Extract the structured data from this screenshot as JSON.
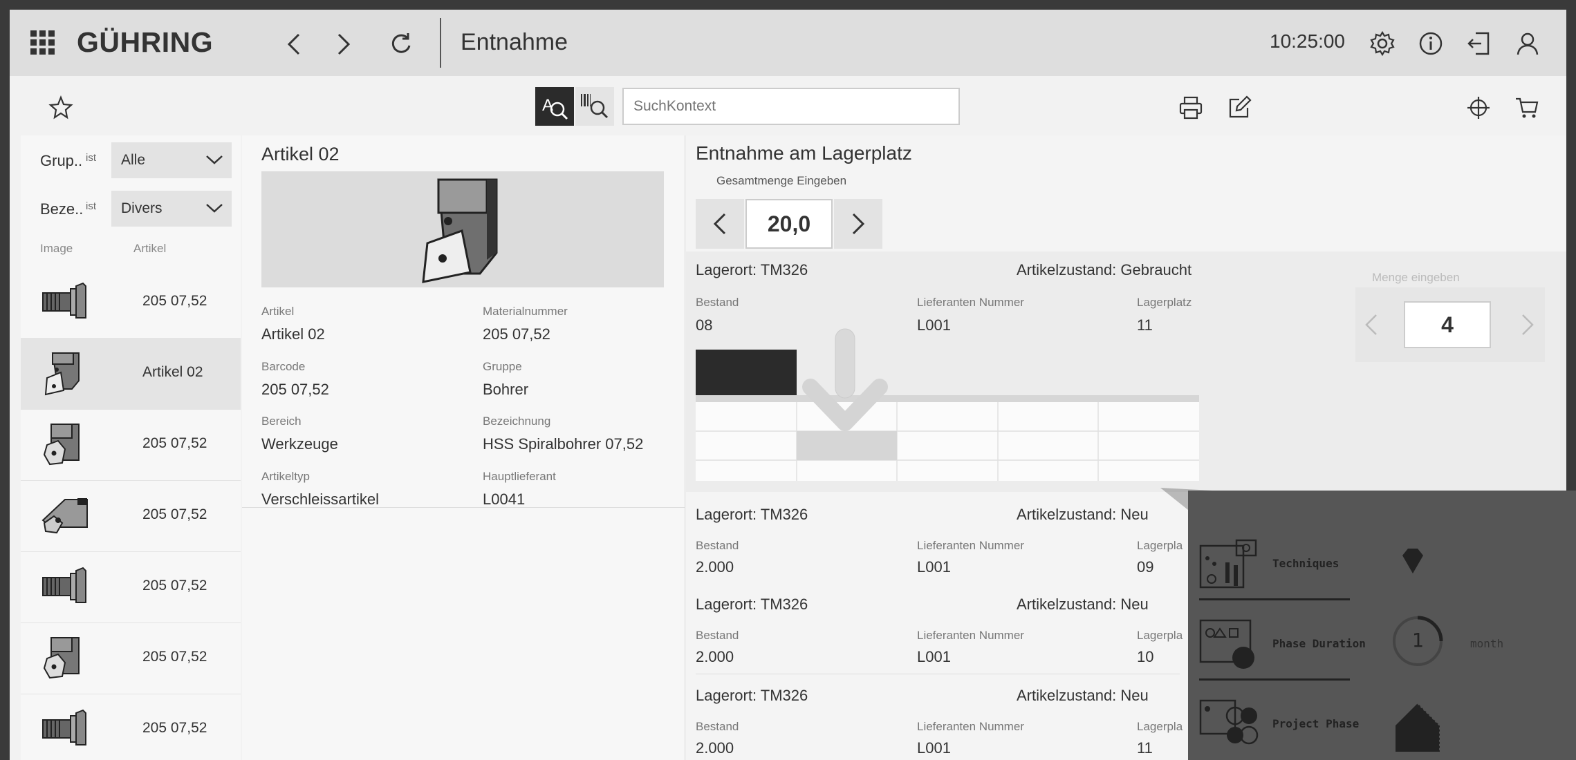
{
  "header": {
    "brand": "GÜHRING",
    "title": "Entnahme",
    "time": "10:25:00"
  },
  "toolbar": {
    "search_placeholder": "SuchKontext"
  },
  "filters": [
    {
      "label": "Grup..",
      "op": "ist",
      "value": "Alle"
    },
    {
      "label": "Beze..",
      "op": "ist",
      "value": "Divers"
    }
  ],
  "list": {
    "col_image": "Image",
    "col_article": "Artikel",
    "items": [
      {
        "label": "205 07,52",
        "icon": "tool-holder-icon"
      },
      {
        "label": "Artikel 02",
        "icon": "insert-tool-icon"
      },
      {
        "label": "205 07,52",
        "icon": "block-tool-icon"
      },
      {
        "label": "205 07,52",
        "icon": "angled-tool-icon"
      },
      {
        "label": "205 07,52",
        "icon": "tool-holder-icon"
      },
      {
        "label": "205 07,52",
        "icon": "block-tool-icon"
      },
      {
        "label": "205 07,52",
        "icon": "tool-holder-icon"
      }
    ]
  },
  "detail": {
    "title": "Artikel 02",
    "fields": [
      {
        "label": "Artikel",
        "value": "Artikel 02"
      },
      {
        "label": "Materialnummer",
        "value": "205 07,52"
      },
      {
        "label": "Barcode",
        "value": "205 07,52"
      },
      {
        "label": "Gruppe",
        "value": "Bohrer"
      },
      {
        "label": "Bereich",
        "value": "Werkzeuge"
      },
      {
        "label": "Bezeichnung",
        "value": "HSS Spiralbohrer 07,52"
      },
      {
        "label": "Artikeltyp",
        "value": "Verschleissartikel"
      },
      {
        "label": "Hauptlieferant",
        "value": "L0041"
      }
    ]
  },
  "withdrawal": {
    "title": "Entnahme am Lagerplatz",
    "total_label": "Gesamtmenge Eingeben",
    "total_value": "20,0",
    "qty_label": "Menge eingeben",
    "qty_value": "4",
    "col_stock": "Bestand",
    "col_supplier": "Lieferanten Nummer",
    "col_place": "Lagerplatz",
    "col_place_short": "Lagerpla",
    "locations": [
      {
        "ort": "Lagerort: TM326",
        "zustand": "Artikelzustand: Gebraucht",
        "bestand": "08",
        "lieferant": "L001",
        "platz": "11"
      },
      {
        "ort": "Lagerort: TM326",
        "zustand": "Artikelzustand: Neu",
        "bestand": "2.000",
        "lieferant": "L001",
        "platz": "09"
      },
      {
        "ort": "Lagerort: TM326",
        "zustand": "Artikelzustand: Neu",
        "bestand": "2.000",
        "lieferant": "L001",
        "platz": "10"
      },
      {
        "ort": "Lagerort: TM326",
        "zustand": "Artikelzustand: Neu",
        "bestand": "2.000",
        "lieferant": "L001",
        "platz": "11"
      }
    ]
  },
  "overlay": {
    "rows": [
      {
        "label": "Techniques"
      },
      {
        "label": "Phase Duration",
        "value": "1",
        "unit": "month"
      },
      {
        "label": "Project Phase"
      }
    ]
  }
}
